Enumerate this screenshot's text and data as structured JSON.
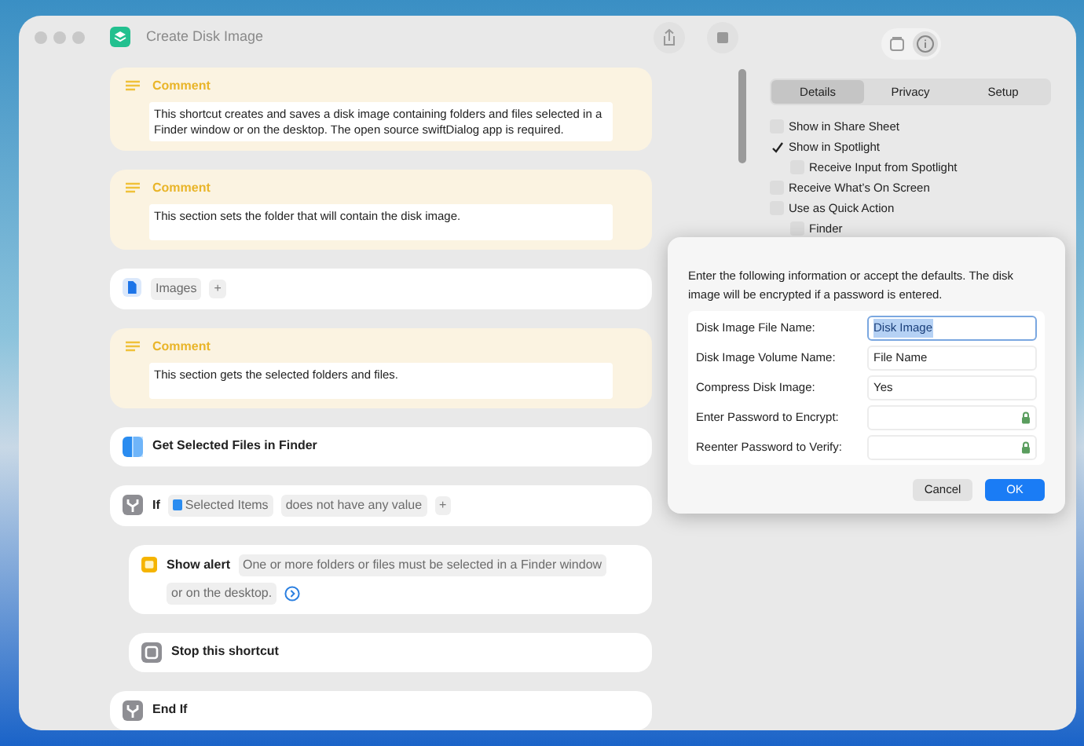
{
  "window": {
    "title": "Create Disk Image"
  },
  "actions": [
    {
      "kind": "comment",
      "title": "Comment",
      "text": "This shortcut creates and saves a disk image containing folders and files selected in a Finder window or on the desktop. The open source swiftDialog app is required."
    },
    {
      "kind": "comment",
      "title": "Comment",
      "text": "This section sets the folder that will contain the disk image."
    },
    {
      "kind": "variable",
      "tokens": [
        "Images"
      ],
      "add": "+"
    },
    {
      "kind": "comment",
      "title": "Comment",
      "text": "This section gets the selected folders and files."
    },
    {
      "kind": "finder",
      "title": "Get Selected Files in Finder"
    },
    {
      "kind": "if",
      "title": "If",
      "tokens": [
        "Selected Items",
        "does not have any value"
      ],
      "add": "+",
      "children": [
        {
          "kind": "alert",
          "title": "Show alert",
          "tokens": [
            "One or more folders or files must be selected in a Finder window",
            "or on the desktop."
          ]
        },
        {
          "kind": "stop",
          "title": "Stop this shortcut"
        }
      ]
    },
    {
      "kind": "endif",
      "title": "End If"
    }
  ],
  "inspector": {
    "tabs": [
      {
        "label": "Details",
        "selected": true
      },
      {
        "label": "Privacy",
        "selected": false
      },
      {
        "label": "Setup",
        "selected": false
      }
    ],
    "options": [
      {
        "label": "Show in Share Sheet",
        "checked": false
      },
      {
        "label": "Show in Spotlight",
        "checked": true,
        "children": [
          {
            "label": "Receive Input from Spotlight",
            "checked": false
          }
        ]
      },
      {
        "label": "Receive What’s On Screen",
        "checked": false
      },
      {
        "label": "Use as Quick Action",
        "checked": false,
        "children": [
          {
            "label": "Finder",
            "checked": false
          }
        ]
      }
    ]
  },
  "dialog": {
    "message": "Enter the following information or accept the defaults. The disk image will be encrypted if a password is entered.",
    "fields": [
      {
        "label": "Disk Image File Name:",
        "value": "Disk Image",
        "kind": "text",
        "focused": true
      },
      {
        "label": "Disk Image Volume Name:",
        "value": "File Name",
        "kind": "text",
        "focused": false
      },
      {
        "label": "Compress Disk Image:",
        "value": "Yes",
        "kind": "text",
        "focused": false
      },
      {
        "label": "Enter Password to Encrypt:",
        "kind": "password",
        "focused": false
      },
      {
        "label": "Reenter Password to Verify:",
        "kind": "password",
        "focused": false
      }
    ],
    "buttons": [
      {
        "label": "Cancel",
        "default": false
      },
      {
        "label": "OK",
        "default": true
      }
    ]
  }
}
